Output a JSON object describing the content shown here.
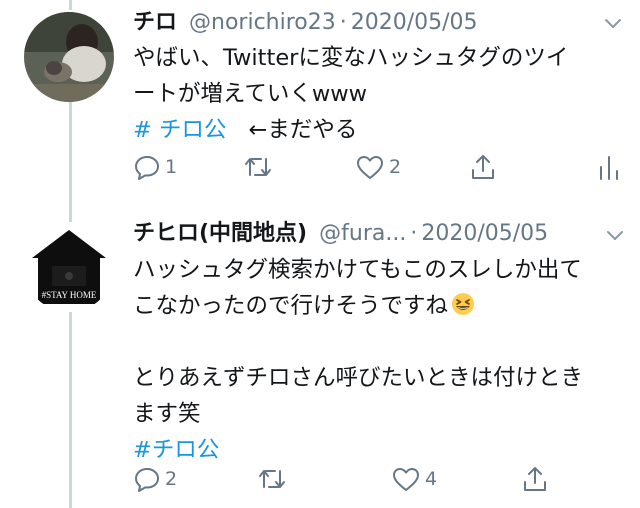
{
  "tweet1": {
    "display_name": "チロ",
    "handle": "@norichiro23",
    "separator": "·",
    "date": "2020/05/05",
    "lines": [
      "やばい、Twitterに変なハッシュタグのツイ",
      "ートが増えていくwww"
    ],
    "hashtag": "# チロ公",
    "reply_note": "←まだやる",
    "reply_count": "1",
    "like_count": "2"
  },
  "tweet2": {
    "display_name": "チヒロ(中間地点)",
    "handle": "@fura...",
    "separator": "·",
    "date": "2020/05/05",
    "avatar_text": "#STAY HOME",
    "lines": [
      "ハッシュタグ検索かけてもこのスレしか出て",
      "こなかったので行けそうですね",
      "",
      "とりあえずチロさん呼びたいときは付けとき",
      "ます笑"
    ],
    "emoji": "grinning-squinting-face",
    "hashtag": "#チロ公",
    "reply_count": "2",
    "like_count": "4"
  },
  "colors": {
    "text": "#14171a",
    "secondary": "#657786",
    "link": "#1b95e0",
    "thread_line": "#ccd6dd"
  }
}
